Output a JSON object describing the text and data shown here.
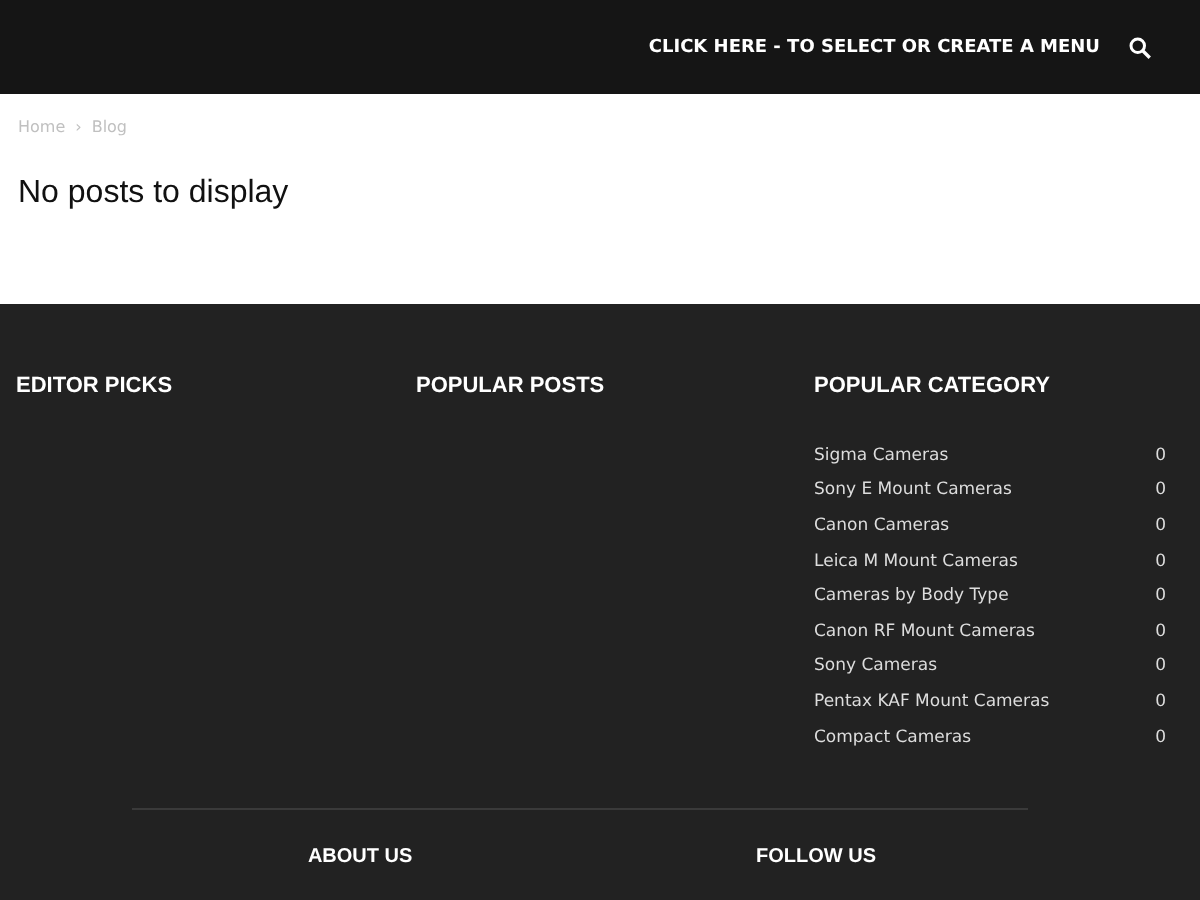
{
  "header": {
    "menu_link": "CLICK HERE - TO SELECT OR CREATE A MENU"
  },
  "breadcrumbs": [
    {
      "label": "Home"
    },
    {
      "label": "Blog"
    }
  ],
  "breadcrumb_separator": "›",
  "message": "No posts to display",
  "footer": {
    "columns": [
      {
        "title": "EDITOR PICKS"
      },
      {
        "title": "POPULAR POSTS"
      },
      {
        "title": "POPULAR CATEGORY"
      }
    ],
    "categories": [
      {
        "name": "Sigma Cameras",
        "count": "0"
      },
      {
        "name": "Sony E Mount Cameras",
        "count": "0"
      },
      {
        "name": "Canon Cameras",
        "count": "0"
      },
      {
        "name": "Leica M Mount Cameras",
        "count": "0"
      },
      {
        "name": "Cameras by Body Type",
        "count": "0"
      },
      {
        "name": "Canon RF Mount Cameras",
        "count": "0"
      },
      {
        "name": "Sony Cameras",
        "count": "0"
      },
      {
        "name": "Pentax KAF Mount Cameras",
        "count": "0"
      },
      {
        "name": "Compact Cameras",
        "count": "0"
      }
    ],
    "bottom_headings": [
      {
        "title": "ABOUT US"
      },
      {
        "title": "FOLLOW US"
      }
    ]
  }
}
